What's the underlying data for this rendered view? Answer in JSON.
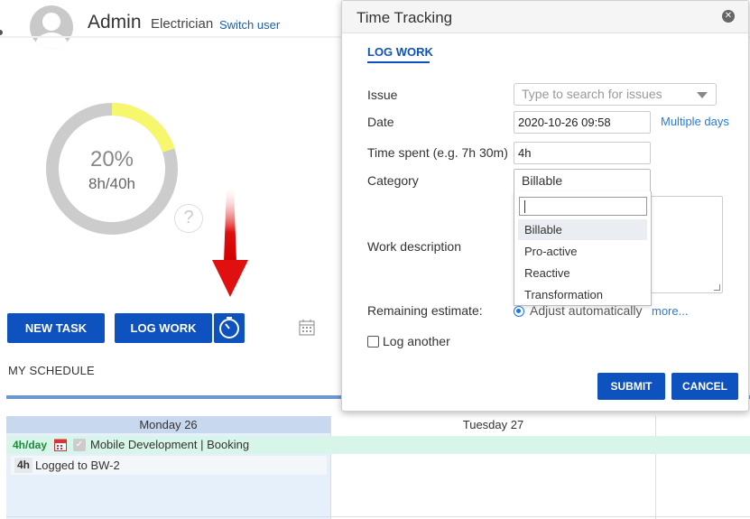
{
  "header": {
    "user_name": "Admin",
    "user_role": "Electrician",
    "switch_user": "Switch user"
  },
  "progress": {
    "percent_label": "20%",
    "hours_label": "8h/40h",
    "fraction": 0.2,
    "filled_color": "#f7f76e",
    "track_color": "#cccccc",
    "help_symbol": "?"
  },
  "actions": {
    "new_task": "NEW TASK",
    "log_work": "LOG WORK",
    "timer_icon": "stopwatch-icon",
    "calendar_icon": "calendar-icon"
  },
  "schedule": {
    "title": "MY SCHEDULE",
    "days": [
      "Monday 26",
      "Tuesday 27"
    ],
    "booking": {
      "rate": "4h/day",
      "label": "Mobile Development | Booking"
    },
    "logged": {
      "hours": "4h",
      "text": "Logged to BW-2"
    }
  },
  "modal": {
    "title": "Time Tracking",
    "tab": "LOG WORK",
    "fields": {
      "issue_label": "Issue",
      "issue_placeholder": "Type to search for issues",
      "date_label": "Date",
      "date_value": "2020-10-26 09:58",
      "multiple_days": "Multiple days",
      "time_label": "Time spent (e.g. 7h 30m)",
      "time_value": "4h",
      "category_label": "Category",
      "category_value": "Billable",
      "category_options": [
        "Billable",
        "Pro-active",
        "Reactive",
        "Transformation"
      ],
      "description_label": "Work description",
      "remaining_label": "Remaining estimate:",
      "remaining_option": "Adjust automatically",
      "more": "more..."
    },
    "log_another": "Log another",
    "submit": "SUBMIT",
    "cancel": "CANCEL"
  },
  "colors": {
    "primary": "#0d52bf",
    "link": "#2a7ae2",
    "arrow_red": "#e01010",
    "booking_bg": "#d7f5e8",
    "booking_rate": "#1e8a3c"
  }
}
